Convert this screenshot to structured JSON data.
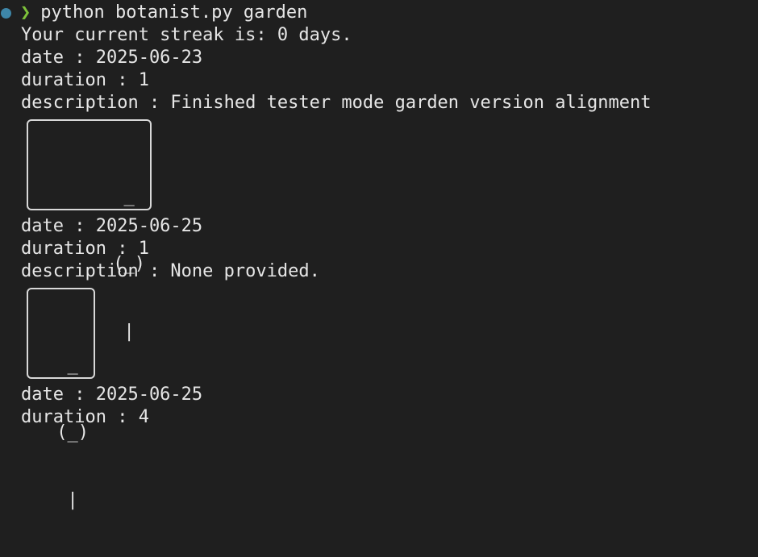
{
  "prompt": {
    "symbol": "❯",
    "command": "python botanist.py garden"
  },
  "streak_line": "Your current streak is: 0 days.",
  "entries": [
    {
      "date": "date : 2025-06-23",
      "duration": "duration : 1",
      "description": "description : Finished tester mode garden version alignment",
      "plant": [
        "  _ ",
        " (_)",
        "  | "
      ]
    },
    {
      "date": "date : 2025-06-25",
      "duration": "duration : 1",
      "description": "description : None provided.",
      "plant": [
        "  _ ",
        " (_)",
        "  | "
      ]
    },
    {
      "date": "date : 2025-06-25",
      "duration": "duration : 4"
    }
  ],
  "colors": {
    "background": "#1f1f1f",
    "text": "#e6e6e6",
    "prompt_chevron": "#7ec33a",
    "status_dot": "#3e86a8",
    "box_border": "#d8d8d8"
  }
}
